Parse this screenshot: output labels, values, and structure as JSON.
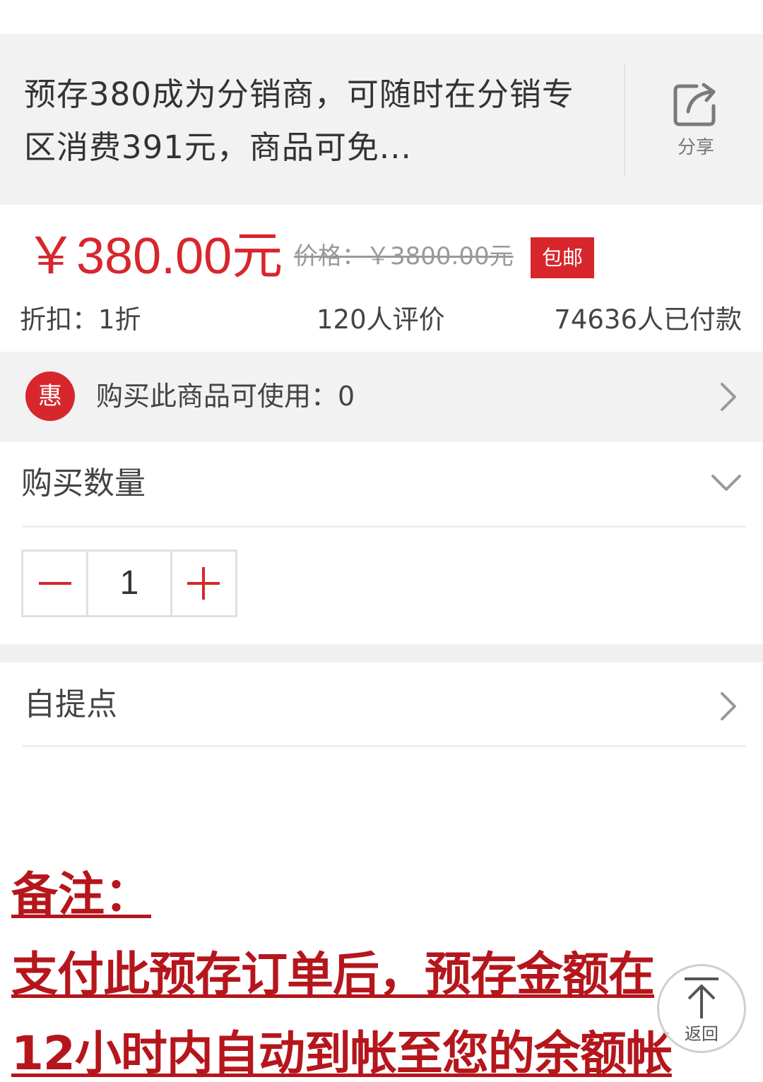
{
  "product": {
    "title": "预存380成为分销商，可随时在分销专区消费391元，商品可免...",
    "share_label": "分享",
    "price": "￥380.00元",
    "original_price": "价格：￥3800.00元",
    "free_shipping_tag": "包邮",
    "discount": "折扣：1折",
    "reviews": "120人评价",
    "paid_count": "74636人已付款"
  },
  "coupon": {
    "badge": "惠",
    "text": "购买此商品可使用：0"
  },
  "quantity": {
    "title": "购买数量",
    "value": "1"
  },
  "pickup": {
    "label": "自提点"
  },
  "note": {
    "line1": "备注：",
    "line2": "支付此预存订单后，预存金额在",
    "line3": "12小时内自动到帐至您的余额帐"
  },
  "back_top": {
    "label": "返回"
  },
  "colors": {
    "accent": "#d7262c",
    "note": "#b5161c",
    "panel": "#f2f2f2"
  }
}
